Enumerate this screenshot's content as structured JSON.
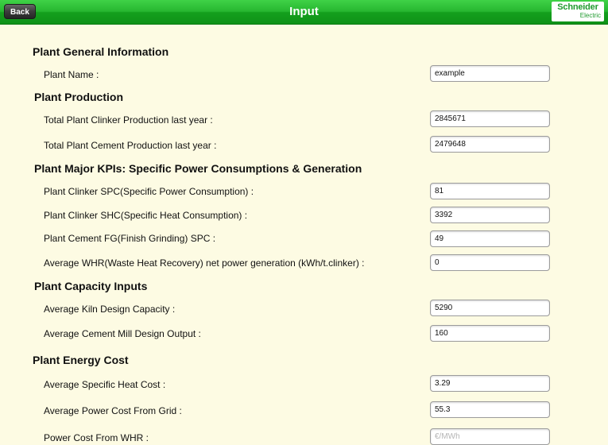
{
  "header": {
    "back_label": "Back",
    "title": "Input",
    "logo_line1": "Schneider",
    "logo_line2": "Electric",
    "accent_color": "#1fa82a"
  },
  "sections": {
    "general": "Plant General Information",
    "production": "Plant Production",
    "kpis": "Plant Major KPIs: Specific Power Consumptions & Generation",
    "capacity": "Plant Capacity Inputs",
    "energy_cost": "Plant Energy Cost"
  },
  "fields": {
    "plant_name": {
      "label": "Plant Name :",
      "value": "example"
    },
    "clinker_production": {
      "label": "Total Plant Clinker Production last year :",
      "value": "2845671"
    },
    "cement_production": {
      "label": "Total Plant Cement  Production last year :",
      "value": "2479648"
    },
    "clinker_spc": {
      "label": "Plant Clinker SPC(Specific Power Consumption) :",
      "value": "81"
    },
    "clinker_shc": {
      "label": "Plant Clinker SHC(Specific Heat Consumption) :",
      "value": "3392"
    },
    "cement_fg_spc": {
      "label": "Plant Cement FG(Finish Grinding) SPC  :",
      "value": "49"
    },
    "whr_generation": {
      "label": "Average WHR(Waste Heat Recovery) net power generation (kWh/t.clinker) :",
      "value": "0"
    },
    "kiln_capacity": {
      "label": "Average Kiln Design Capacity  :",
      "value": "5290"
    },
    "mill_output": {
      "label": "Average Cement Mill Design Output  :",
      "value": "160"
    },
    "heat_cost": {
      "label": "Average Specific Heat Cost :",
      "value": "3.29"
    },
    "grid_power_cost": {
      "label": "Average Power Cost From Grid :",
      "value": "55.3"
    },
    "whr_power_cost": {
      "label": "Power Cost From WHR :",
      "value": "",
      "placeholder": "€/MWh"
    }
  }
}
